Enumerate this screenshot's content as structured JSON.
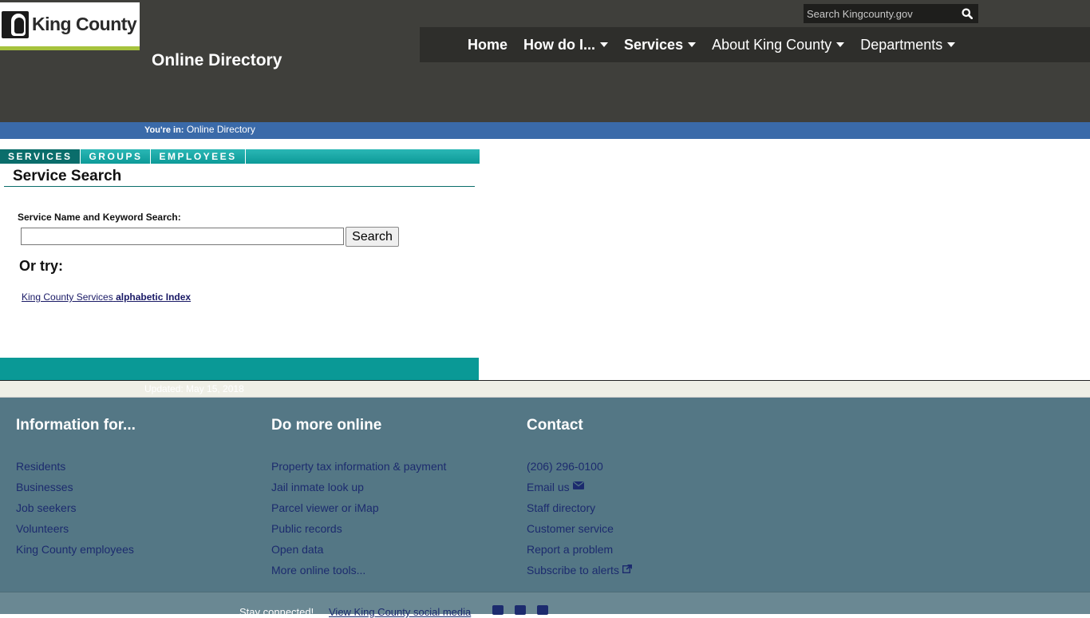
{
  "header": {
    "logo_text": "King County",
    "site_title": "Online Directory",
    "search_placeholder": "Search Kingcounty.gov"
  },
  "nav": {
    "items": [
      {
        "label": "Home"
      },
      {
        "label": "How do I..."
      },
      {
        "label": "Services"
      },
      {
        "label": "About King County"
      },
      {
        "label": "Departments"
      }
    ]
  },
  "breadcrumb": {
    "prefix": "You're in:",
    "current": "Online Directory"
  },
  "tabs": [
    {
      "label": "SERVICES"
    },
    {
      "label": "GROUPS"
    },
    {
      "label": "EMPLOYEES"
    }
  ],
  "search_panel": {
    "title": "Service Search",
    "field_label": "Service Name and Keyword Search:",
    "input_value": "",
    "button_label": "Search",
    "or_try": "Or try:",
    "index_link_prefix": "King County Services",
    "index_link_bold": "alphabetic Index"
  },
  "updated": "Updated: May 15, 2018",
  "footer": {
    "columns": [
      {
        "heading": "Information for...",
        "items": [
          "Residents",
          "Businesses",
          "Job seekers",
          "Volunteers",
          "King County employees"
        ]
      },
      {
        "heading": "Do more online",
        "items": [
          "Property tax information & payment",
          "Jail inmate look up",
          "Parcel viewer or iMap",
          "Public records",
          "Open data",
          "More online tools..."
        ]
      },
      {
        "heading": "Contact",
        "items": [
          "(206) 296-0100",
          "Email us",
          "Staff directory",
          "Customer service",
          "Report a problem",
          "Subscribe to alerts"
        ]
      }
    ],
    "stay_connected": "Stay connected!",
    "social_link": "View King County social media"
  },
  "colors": {
    "header_bg": "#3f3f3b",
    "nav_bg": "#2e2e2b",
    "breadcrumb_bg": "#3a6aa9",
    "tab_teal": "#0d9a98",
    "footer_bg": "#547785",
    "link": "#1c2b6e",
    "logo_accent": "#a6c23d"
  }
}
